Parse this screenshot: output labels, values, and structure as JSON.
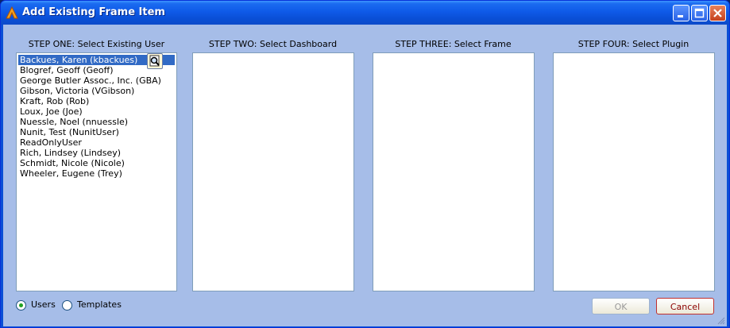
{
  "window": {
    "title": "Add Existing Frame Item",
    "app_icon": "app-logo-icon",
    "controls": [
      "minimize-icon",
      "maximize-icon",
      "close-icon"
    ]
  },
  "steps": {
    "one": {
      "label": "STEP ONE: Select Existing User"
    },
    "two": {
      "label": "STEP TWO: Select Dashboard"
    },
    "three": {
      "label": "STEP THREE: Select Frame"
    },
    "four": {
      "label": "STEP FOUR: Select Plugin"
    }
  },
  "users": [
    "Backues, Karen (kbackues)",
    "Blogref, Geoff (Geoff)",
    "George Butler Assoc., Inc. (GBA)",
    "Gibson, Victoria (VGibson)",
    "Kraft, Rob (Rob)",
    "Loux, Joe (Joe)",
    "Nuessle, Noel (nnuessle)",
    "Nunit, Test (NunitUser)",
    "ReadOnlyUser",
    "Rich, Lindsey (Lindsey)",
    "Schmidt, Nicole (Nicole)",
    "Wheeler, Eugene (Trey)"
  ],
  "selected_user_index": 0,
  "lookup_icon": "magnifier-icon",
  "source": {
    "options": [
      "Users",
      "Templates"
    ],
    "selected": "Users"
  },
  "buttons": {
    "ok": "OK",
    "cancel": "Cancel"
  },
  "colors": {
    "titlebar": "#0a4fd6",
    "client": "#a6bde8",
    "selection": "#316ac5",
    "radio_dot": "#21a121",
    "cancel_text": "#8b0000"
  }
}
